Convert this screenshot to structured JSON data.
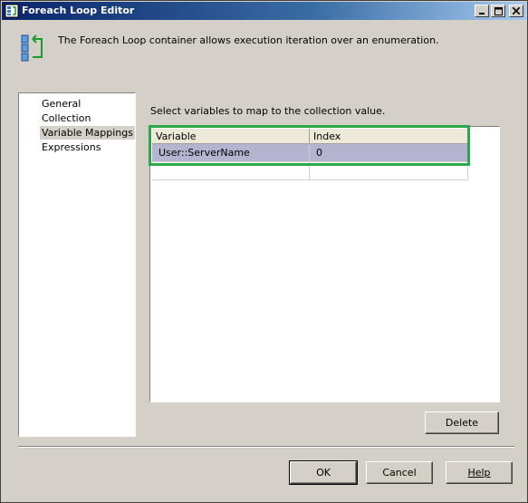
{
  "window": {
    "title": "Foreach Loop Editor"
  },
  "header": {
    "description": "The Foreach Loop container allows execution iteration over an enumeration."
  },
  "nav": {
    "items": [
      {
        "label": "General"
      },
      {
        "label": "Collection"
      },
      {
        "label": "Variable Mappings",
        "selected": true
      },
      {
        "label": "Expressions"
      }
    ]
  },
  "main": {
    "prompt": "Select variables to map to the collection value.",
    "columns": [
      "Variable",
      "Index"
    ],
    "rows": [
      {
        "variable": "User::ServerName",
        "index": "0"
      }
    ],
    "delete_label": "Delete"
  },
  "footer": {
    "ok_label": "OK",
    "cancel_label": "Cancel",
    "help_label": "Help"
  },
  "colors": {
    "highlight": "#2aa84a",
    "selected_row": "#b4b4d0",
    "titlebar": "#0a246a"
  },
  "icons": {
    "title": "foreach-loop-icon",
    "header": "foreach-loop-container-icon"
  }
}
